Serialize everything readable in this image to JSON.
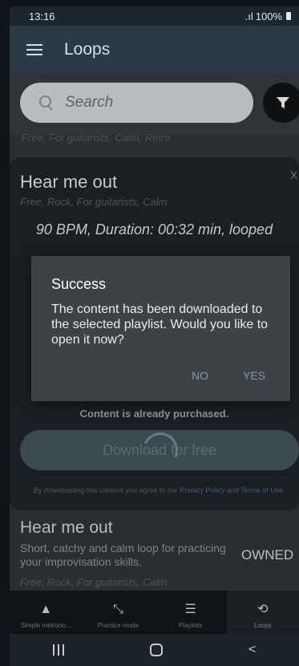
{
  "status_bar": {
    "time": "13:16",
    "signal": ".ıl",
    "battery": "100%"
  },
  "app_bar": {
    "title": "Loops",
    "menu_icon": "hamburger-menu-icon"
  },
  "search": {
    "placeholder": "Search",
    "filter_icon": "funnel-filter-icon"
  },
  "list_tags_top": "Free, For guitarists, Calm, Retro",
  "detail_card": {
    "title": "Hear me out",
    "close_label": "X",
    "tags": "Free, Rock, For guitarists, Calm",
    "bpm_line": "90 BPM, Duration: 00:32 min, looped",
    "purchased_text": "Content is already purchased.",
    "download_label": "Download for free",
    "agreement_prefix": "By downloading this content you agree to our ",
    "privacy_link": "Privacy Policy",
    "agreement_and": " and ",
    "terms_link": "Terms of Use"
  },
  "list_item": {
    "title": "Hear me out",
    "description": "Short, catchy and calm loop for practicing your improvisation skills.",
    "status": "OWNED",
    "tags": "Free, Rock, For guitarists, Calm"
  },
  "bottom_nav": [
    {
      "label": "Simple metrono...",
      "icon": "metronome-icon",
      "active": false
    },
    {
      "label": "Practice mode",
      "icon": "practice-arrows-icon",
      "active": false
    },
    {
      "label": "Playlists",
      "icon": "playlist-icon",
      "active": false
    },
    {
      "label": "Loops",
      "icon": "loop-icon",
      "active": true
    }
  ],
  "dialog": {
    "title": "Success",
    "message": "The content has been downloaded to the selected playlist. Would you like to open it now?",
    "no_label": "NO",
    "yes_label": "YES"
  },
  "system_nav": {
    "back_glyph": "<"
  },
  "colors": {
    "accent_dialog_button": "#7f97ab",
    "app_bar": "#2b3a44",
    "dialog_bg": "#3e4246"
  }
}
